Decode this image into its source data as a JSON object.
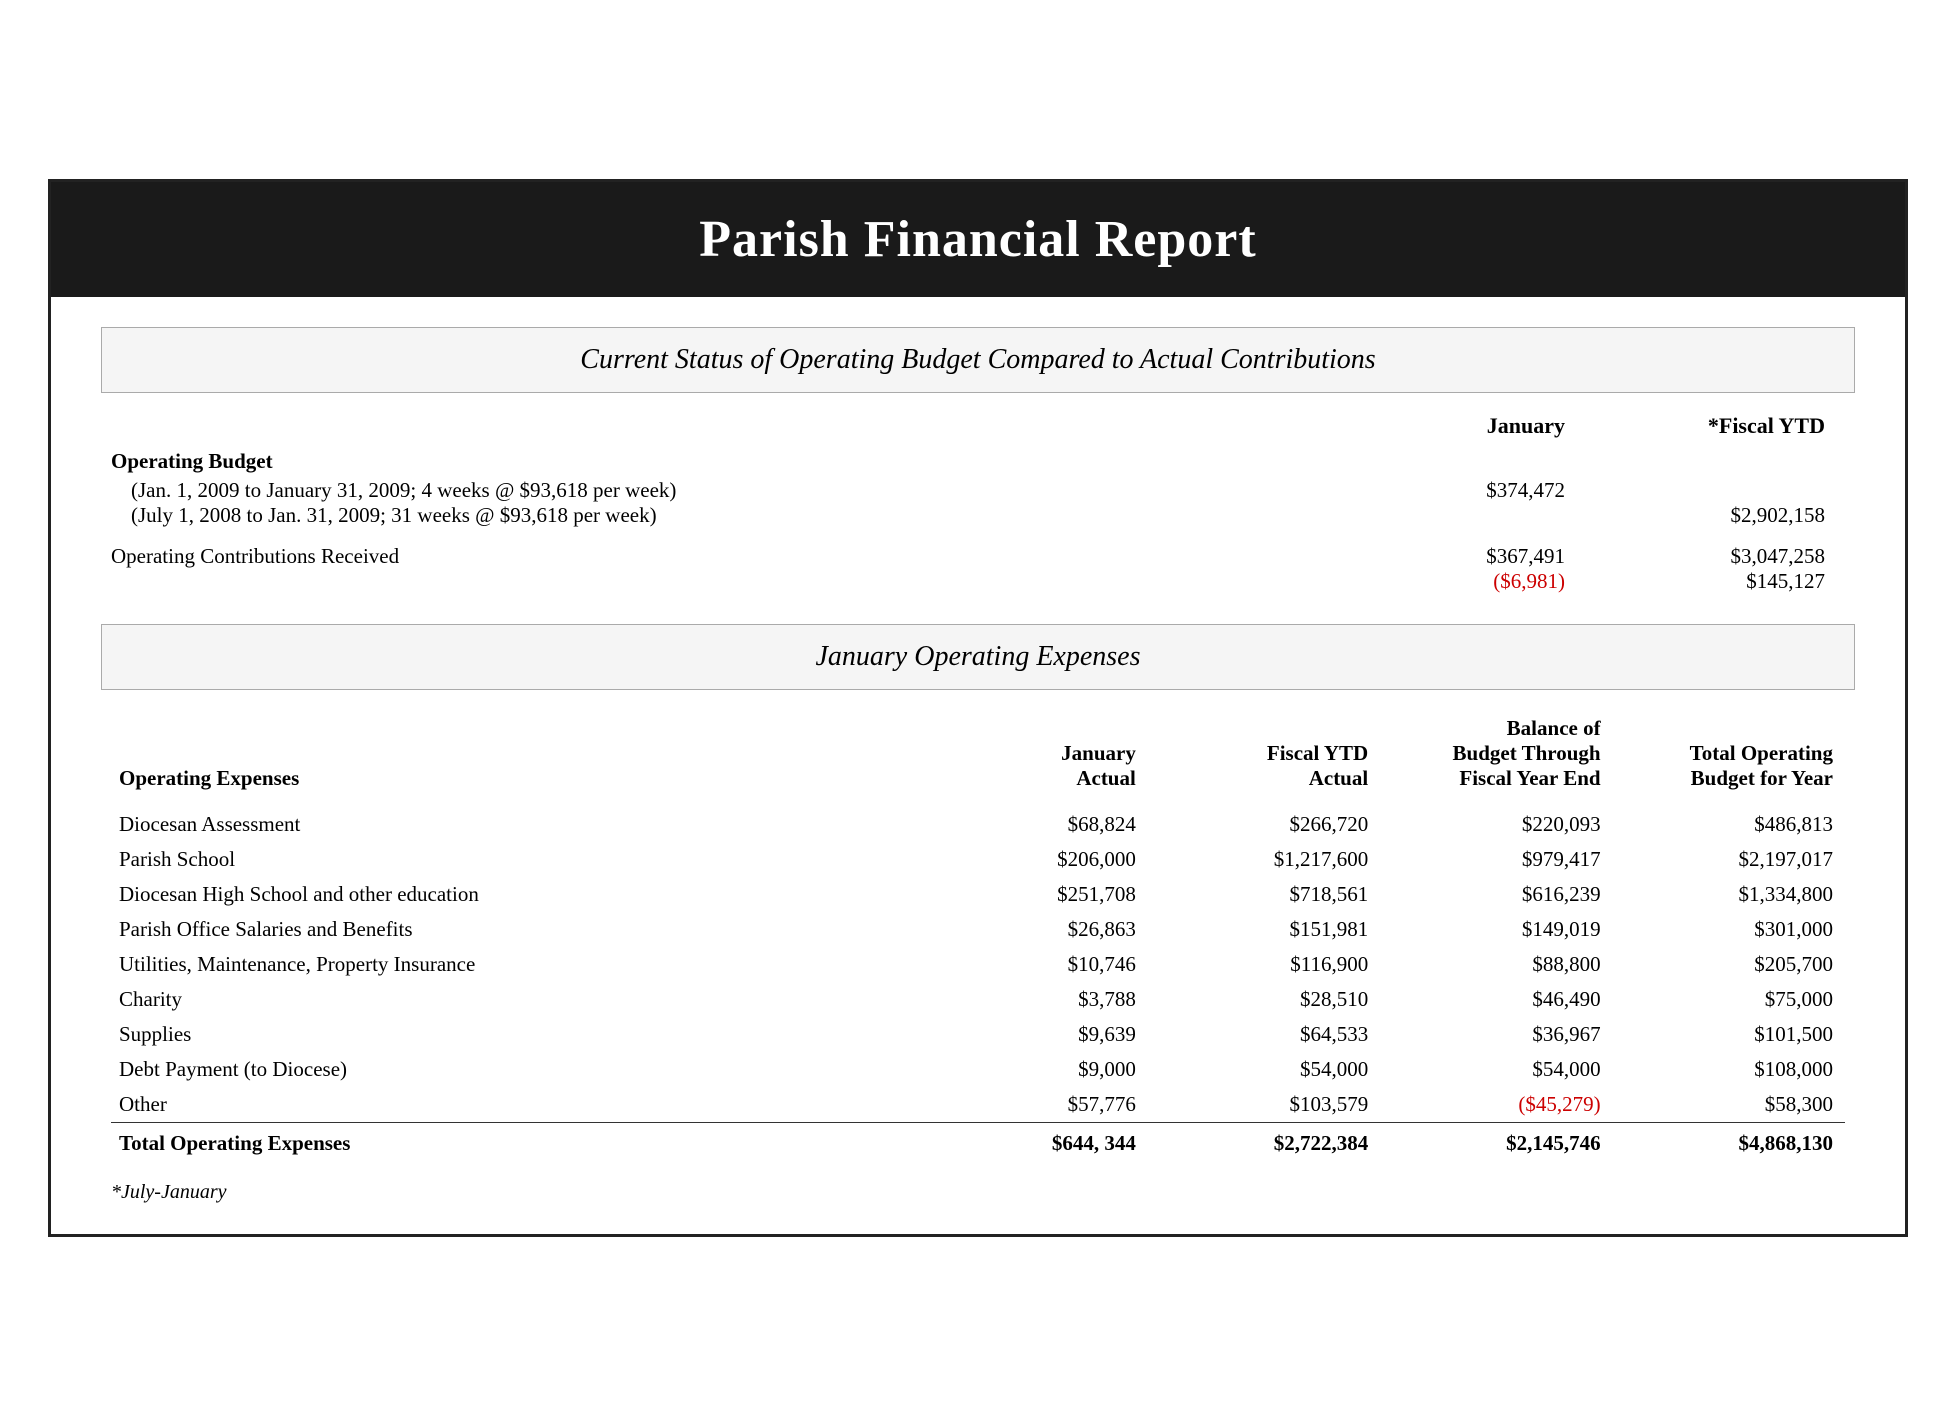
{
  "header": {
    "title": "Parish Financial Report"
  },
  "section1": {
    "title": "Current Status of Operating Budget Compared to Actual Contributions"
  },
  "columns": {
    "january": "January",
    "fiscal_ytd": "*Fiscal YTD"
  },
  "operating_budget": {
    "label": "Operating Budget",
    "line1": "(Jan. 1, 2009 to January 31, 2009; 4 weeks @ $93,618 per week)",
    "line1_jan": "$374,472",
    "line1_ytd": "",
    "line2": "(July 1, 2008 to Jan. 31, 2009; 31 weeks @ $93,618 per week)",
    "line2_jan": "",
    "line2_ytd": "$2,902,158"
  },
  "operating_contributions": {
    "label": "Operating Contributions Received",
    "jan_value": "$367,491",
    "jan_diff": "($6,981)",
    "ytd_value": "$3,047,258",
    "ytd_diff": "$145,127"
  },
  "section2": {
    "title": "January Operating Expenses"
  },
  "expenses_table": {
    "col1": "Operating Expenses",
    "col2_line1": "January",
    "col2_line2": "Actual",
    "col3_line1": "Fiscal YTD",
    "col3_line2": "Actual",
    "col4_line1": "Balance of",
    "col4_line2": "Budget Through",
    "col4_line3": "Fiscal Year End",
    "col5_line1": "Total Operating",
    "col5_line2": "Budget for Year",
    "rows": [
      {
        "label": "Diocesan Assessment",
        "jan": "$68,824",
        "ytd": "$266,720",
        "balance": "$220,093",
        "total": "$486,813",
        "balance_negative": false
      },
      {
        "label": "Parish School",
        "jan": "$206,000",
        "ytd": "$1,217,600",
        "balance": "$979,417",
        "total": "$2,197,017",
        "balance_negative": false
      },
      {
        "label": "Diocesan High School and other education",
        "jan": "$251,708",
        "ytd": "$718,561",
        "balance": "$616,239",
        "total": "$1,334,800",
        "balance_negative": false
      },
      {
        "label": "Parish Office Salaries and Benefits",
        "jan": "$26,863",
        "ytd": "$151,981",
        "balance": "$149,019",
        "total": "$301,000",
        "balance_negative": false
      },
      {
        "label": "Utilities, Maintenance, Property Insurance",
        "jan": "$10,746",
        "ytd": "$116,900",
        "balance": "$88,800",
        "total": "$205,700",
        "balance_negative": false
      },
      {
        "label": "Charity",
        "jan": "$3,788",
        "ytd": "$28,510",
        "balance": "$46,490",
        "total": "$75,000",
        "balance_negative": false
      },
      {
        "label": "Supplies",
        "jan": "$9,639",
        "ytd": "$64,533",
        "balance": "$36,967",
        "total": "$101,500",
        "balance_negative": false
      },
      {
        "label": "Debt Payment (to Diocese)",
        "jan": "$9,000",
        "ytd": "$54,000",
        "balance": "$54,000",
        "total": "$108,000",
        "balance_negative": false
      },
      {
        "label": "Other",
        "jan": "$57,776",
        "ytd": "$103,579",
        "balance": "($45,279)",
        "total": "$58,300",
        "balance_negative": true
      }
    ],
    "total_row": {
      "label": "Total Operating Expenses",
      "jan": "$644, 344",
      "ytd": "$2,722,384",
      "balance": "$2,145,746",
      "total": "$4,868,130"
    }
  },
  "footnote": "*July-January"
}
